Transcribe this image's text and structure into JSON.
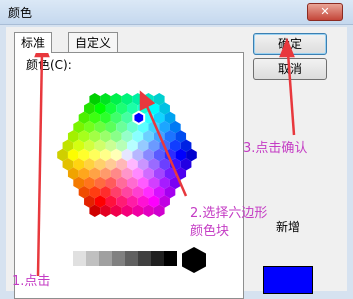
{
  "window": {
    "title": "颜色",
    "close_icon": "close-icon"
  },
  "tabs": [
    {
      "label": "标准"
    },
    {
      "label": "自定义"
    }
  ],
  "color_label": "颜色(C):",
  "buttons": {
    "ok_label": "确定",
    "cancel_label": "取消"
  },
  "new_label": "新增",
  "new_color": "#0000ff",
  "annotations": {
    "step1": "1.点击",
    "step2_line1": "2.选择六边形",
    "step2_line2": "颜色块",
    "step3": "3.点击确认"
  },
  "colors": {
    "annotation": "#c43cc4",
    "arrow": "#e8383d",
    "selected_hex": "#0000ff"
  }
}
